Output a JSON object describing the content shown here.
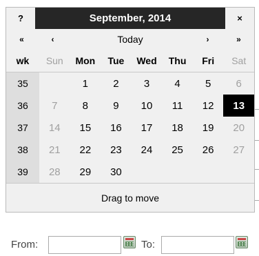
{
  "window": {
    "help_label": "?",
    "title": "September, 2014",
    "close_label": "×"
  },
  "nav": {
    "prev_year": "«",
    "prev_month": "‹",
    "today": "Today",
    "next_month": "›",
    "next_year": "»"
  },
  "headers": [
    "wk",
    "Sun",
    "Mon",
    "Tue",
    "Wed",
    "Thu",
    "Fri",
    "Sat"
  ],
  "weeks": [
    {
      "wk": "35",
      "days": [
        "",
        "1",
        "2",
        "3",
        "4",
        "5",
        "6"
      ]
    },
    {
      "wk": "36",
      "days": [
        "7",
        "8",
        "9",
        "10",
        "11",
        "12",
        "13"
      ]
    },
    {
      "wk": "37",
      "days": [
        "14",
        "15",
        "16",
        "17",
        "18",
        "19",
        "20"
      ]
    },
    {
      "wk": "38",
      "days": [
        "21",
        "22",
        "23",
        "24",
        "25",
        "26",
        "27"
      ]
    },
    {
      "wk": "39",
      "days": [
        "28",
        "29",
        "30",
        "",
        "",
        "",
        ""
      ]
    }
  ],
  "selected_day": "13",
  "footer": "Drag to move",
  "form": {
    "from_label": "From:",
    "from_value": "",
    "to_label": "To:",
    "to_value": ""
  },
  "colors": {
    "title_bg": "#262626",
    "selected_bg": "#000000",
    "weekend_text": "#a0a0a0",
    "week_col_bg": "#dedede"
  }
}
